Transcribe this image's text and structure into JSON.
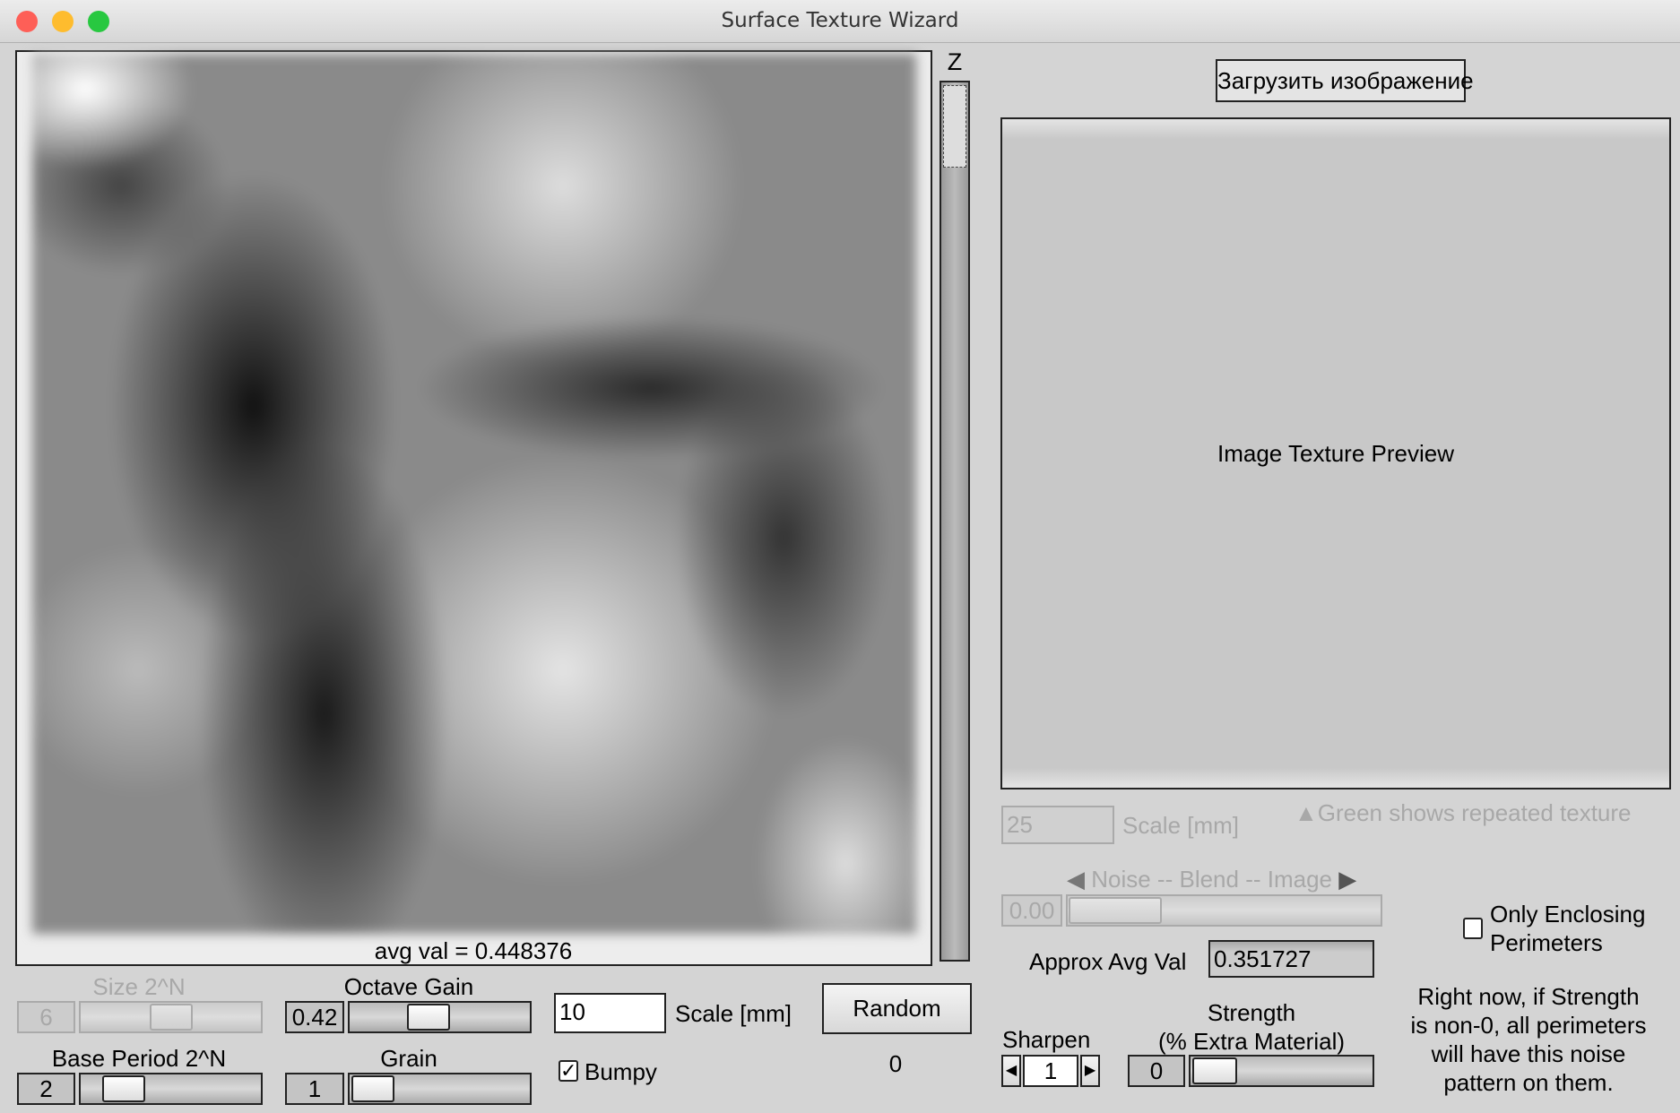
{
  "window": {
    "title": "Surface Texture Wizard"
  },
  "noise_panel": {
    "avg_val": "avg val = 0.448376",
    "z_label": "Z",
    "size": {
      "label": "Size 2^N",
      "value": "6",
      "fraction": 0.45
    },
    "octave_gain": {
      "label": "Octave Gain",
      "value": "0.42",
      "fraction": 0.42
    },
    "base_period": {
      "label": "Base Period 2^N",
      "value": "2",
      "fraction": 0.2
    },
    "grain": {
      "label": "Grain",
      "value": "1",
      "fraction": 0.0
    },
    "scale": {
      "value": "10",
      "label": "Scale [mm]"
    },
    "random_button": "Random",
    "bumpy": {
      "label": "Bumpy",
      "checked": true
    },
    "seed": "0"
  },
  "image_panel": {
    "load_button": "Загрузить изображение",
    "preview_label": "Image Texture Preview",
    "scale": {
      "value": "25",
      "label": "Scale [mm]"
    },
    "green_note": "Green shows repeated texture",
    "blend": {
      "label": "Noise -- Blend -- Image",
      "value": "0.00",
      "fraction": 0.0
    },
    "approx_avg": {
      "label": "Approx Avg Val",
      "value": "0.351727"
    },
    "only_enclosing": {
      "label_line1": "Only Enclosing",
      "label_line2": "Perimeters",
      "checked": false
    },
    "sharpen": {
      "label": "Sharpen",
      "value": "1"
    },
    "strength": {
      "label_line1": "Strength",
      "label_line2": "(% Extra Material)",
      "value": "0",
      "fraction": 0.0
    },
    "note": [
      "Right now, if Strength",
      "is non-0, all perimeters",
      "will have this noise",
      "pattern on them."
    ]
  },
  "colors": {
    "close": "#fe5f57",
    "minimize": "#febc2e",
    "maximize": "#28c840"
  }
}
